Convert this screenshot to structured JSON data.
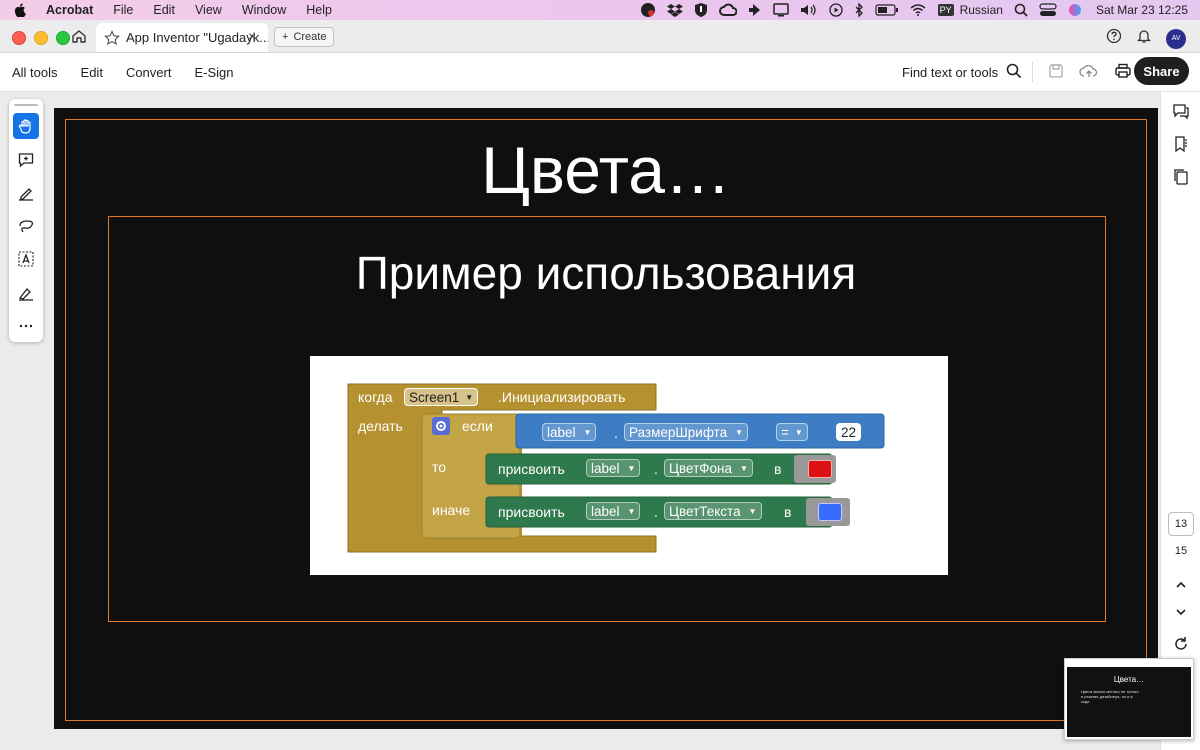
{
  "menubar": {
    "app": "Acrobat",
    "items": [
      "File",
      "Edit",
      "View",
      "Window",
      "Help"
    ],
    "input_badge": "PY",
    "input_source": "Russian",
    "datetime": "Sat Mar 23  12:25"
  },
  "tabbar": {
    "doc_tab": "App Inventor \"Ugadayk...",
    "create_label": "Create",
    "avatar_initials": "AV"
  },
  "toolbar": {
    "items": [
      "All tools",
      "Edit",
      "Convert",
      "E-Sign"
    ],
    "find_label": "Find text or tools",
    "share_label": "Share"
  },
  "slide": {
    "title": "Цвета…",
    "subtitle": "Пример использования",
    "blocks": {
      "when": "когда",
      "component": "Screen1",
      "event": ".Инициализировать",
      "do": "делать",
      "if": "если",
      "label1": "label",
      "prop1": "РазмерШрифта",
      "op": "=",
      "num": "22",
      "then": "то",
      "set": "присвоить",
      "label2": "label",
      "prop2": "ЦветФона",
      "to": "в",
      "else": "иначе",
      "label3": "label",
      "prop3": "ЦветТекста",
      "dot": "."
    },
    "colors": {
      "red_swatch": "#dd1111",
      "blue_swatch": "#3a6bff",
      "event_block": "#b5922f",
      "logic_block": "#3c7dc4",
      "set_block": "#2f7a4c"
    }
  },
  "pages": {
    "current": "13",
    "total": "15"
  },
  "thumbnail": {
    "title": "Цвета…",
    "text": "Цвета можно менять не только в режиме дизайнера, но и в коде."
  }
}
